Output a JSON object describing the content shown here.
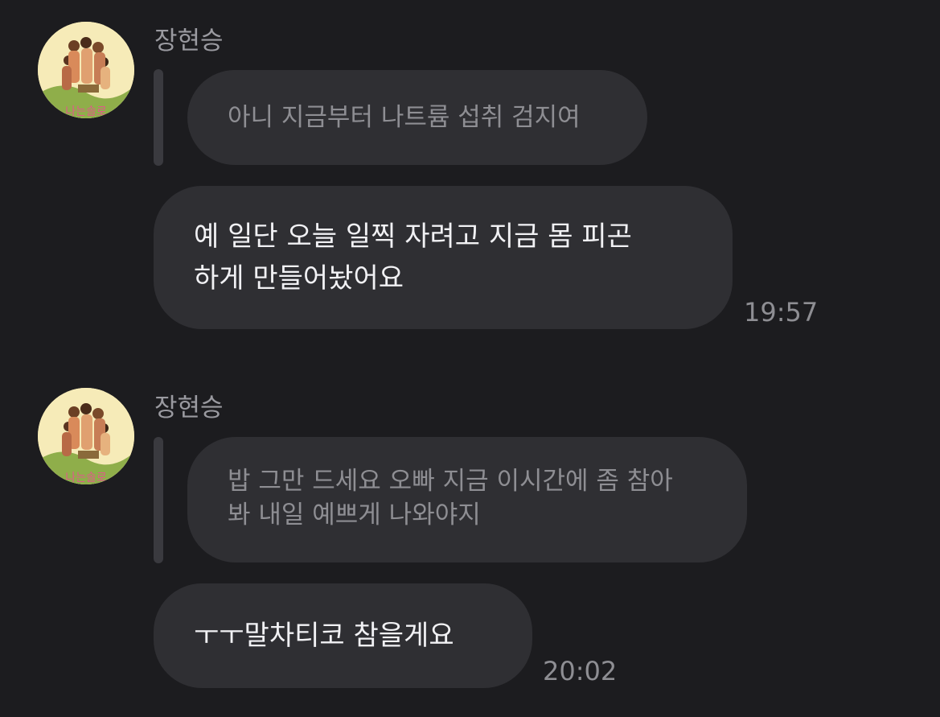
{
  "messages": [
    {
      "sender": "장현승",
      "quoted_text": "아니 지금부터 나트륨 섭취 검지여",
      "text_line1": "예 일단 오늘 일찍 자려고 지금 몸 피곤",
      "text_line2": "하게 만들어놨어요",
      "time": "19:57"
    },
    {
      "sender": "장현승",
      "quoted_text_line1": "밥 그만 드세요 오빠 지금 이시간에 좀 참아",
      "quoted_text_line2": "봐 내일 예쁘게 나와야지",
      "text_line1": "ㅜㅜ말차티코 참을게요",
      "time": "20:02"
    }
  ],
  "icons": {
    "avatar": "profile-photo-group"
  },
  "colors": {
    "background": "#1c1c1f",
    "bubble": "#2f2f33",
    "reply_bar": "#3a3a3f",
    "message_text": "#f1f1f4",
    "secondary_text": "#8e8e93"
  }
}
